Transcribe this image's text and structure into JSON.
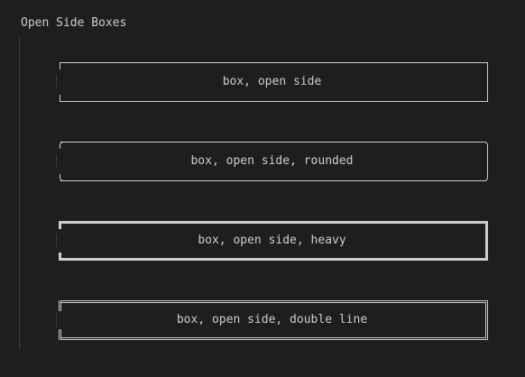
{
  "section": {
    "title": "Open Side Boxes"
  },
  "boxes": [
    {
      "label": "box, open side"
    },
    {
      "label": "box, open side, rounded"
    },
    {
      "label": "box, open side, heavy"
    },
    {
      "label": "box, open side, double line"
    }
  ],
  "colors": {
    "background": "#1e1e1e",
    "text": "#cccccc",
    "border": "#cccccc",
    "guide": "#3a3a3a"
  }
}
